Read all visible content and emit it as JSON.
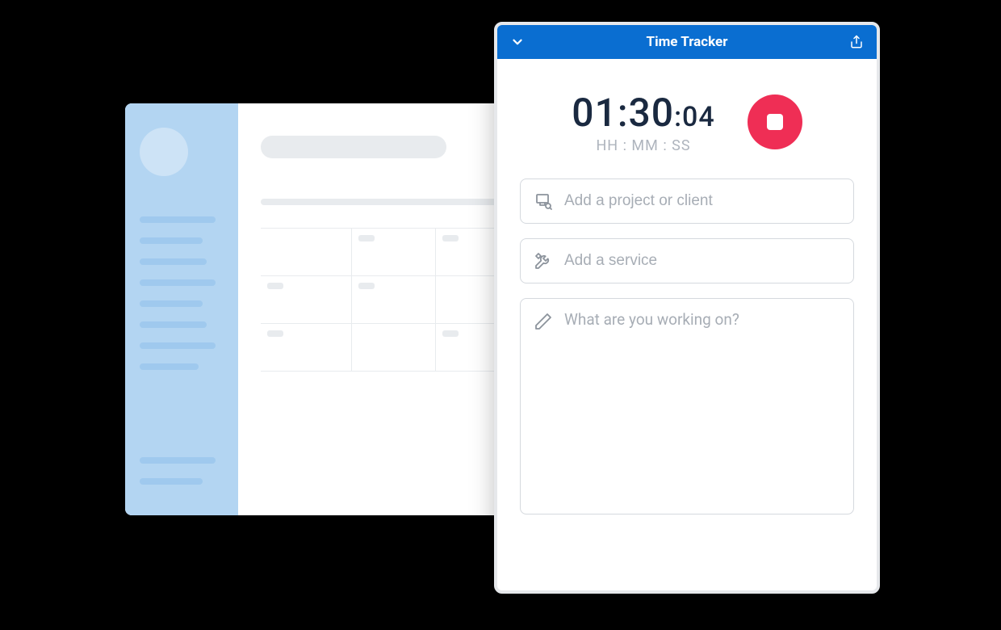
{
  "tracker": {
    "title": "Time Tracker",
    "timer": {
      "hh_mm": "01:30",
      "ss": ":04",
      "labels": "HH : MM : SS"
    },
    "stop_button": "Stop",
    "fields": {
      "project_placeholder": "Add a project or client",
      "service_placeholder": "Add a service",
      "notes_placeholder": "What are you working on?"
    }
  },
  "colors": {
    "header_blue": "#0a6ed1",
    "stop_red": "#ef2e55",
    "placeholder_gray": "#a7adb5"
  }
}
